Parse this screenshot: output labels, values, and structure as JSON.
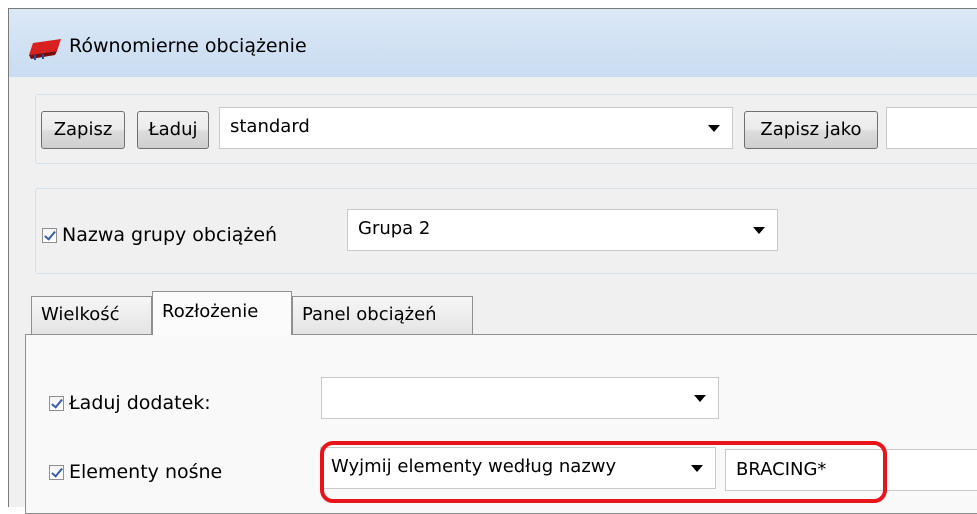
{
  "window": {
    "title": "Równomierne obciążenie"
  },
  "toolbar": {
    "save_label": "Zapisz",
    "load_label": "Ładuj",
    "preset_value": "standard",
    "save_as_label": "Zapisz jako",
    "save_as_value": ""
  },
  "load_group": {
    "checked": true,
    "label": "Nazwa grupy obciążeń",
    "value": "Grupa 2"
  },
  "tabs": [
    {
      "label": "Wielkość",
      "active": false
    },
    {
      "label": "Rozłożenie",
      "active": true
    },
    {
      "label": "Panel obciążeń",
      "active": false
    }
  ],
  "distribution": {
    "load_additional": {
      "checked": true,
      "label": "Ładuj dodatek:",
      "value": ""
    },
    "bearing_elements": {
      "checked": true,
      "label": "Elementy nośne",
      "mode_value": "Wyjmij elementy według nazwy",
      "filter_value": "BRACING*"
    }
  },
  "colors": {
    "titlebar": "#c9dcf1",
    "highlight": "#e8141a",
    "checkmark": "#3a5ea8"
  },
  "icons": {
    "app": "red-load-icon",
    "dropdown": "triangle-down"
  }
}
